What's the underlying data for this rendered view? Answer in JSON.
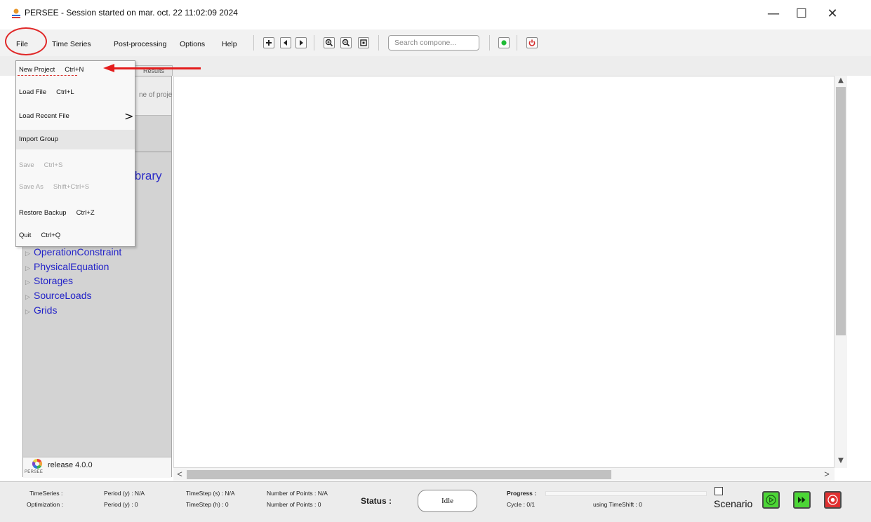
{
  "window": {
    "title": "PERSEE - Session started on mar. oct. 22 11:02:09 2024",
    "minimize_glyph": "—",
    "maximize_glyph": "☐",
    "close_glyph": "✕"
  },
  "menubar": {
    "items": [
      "File",
      "Time Series",
      "Post-processing",
      "Options",
      "Help"
    ],
    "search_placeholder": "Search compone..."
  },
  "tabs": {
    "results": "Results"
  },
  "left_panel": {
    "project_name_fragment": "ne of proje",
    "library_fragment": "ibrary",
    "tree_items": [
      "OperationConstraint",
      "PhysicalEquation",
      "Storages",
      "SourceLoads",
      "Grids"
    ],
    "tree_triangle": "▷",
    "logo_text": "PERSEE",
    "release": "release 4.0.0"
  },
  "file_menu": {
    "items": [
      {
        "label": "New Project",
        "shortcut": "Ctrl+N",
        "enabled": true
      },
      {
        "label": "Load File",
        "shortcut": "Ctrl+L",
        "enabled": true
      },
      {
        "label": "Load Recent File",
        "shortcut": "",
        "submenu_arrow": ">",
        "enabled": true
      },
      {
        "label": "Import Group",
        "shortcut": "",
        "enabled": true,
        "hovered": true
      },
      {
        "label": "Save",
        "shortcut": "Ctrl+S",
        "enabled": false
      },
      {
        "label": "Save As",
        "shortcut": "Shift+Ctrl+S",
        "enabled": false
      },
      {
        "label": "Restore Backup",
        "shortcut": "Ctrl+Z",
        "enabled": true
      },
      {
        "label": "Quit",
        "shortcut": "Ctrl+Q",
        "enabled": true
      }
    ]
  },
  "scroll": {
    "up": "▲",
    "down": "▼",
    "left": "<",
    "right": ">"
  },
  "status": {
    "ts_label": "TimeSeries :",
    "opt_label": "Optimization :",
    "period_y_ts": "Period (y) : N/A",
    "period_y_opt": "Period (y) : 0",
    "timestep_s": "TimeStep (s) : N/A",
    "timestep_h": "TimeStep (h) : 0",
    "npoints_ts": "Number of Points : N/A",
    "npoints_opt": "Number of Points : 0",
    "status_label": "Status :",
    "status_value": "Idle",
    "progress_label": "Progress :",
    "progress_value": 0,
    "cycle": "Cycle : 0/1",
    "timeshift": "using TimeShift : 0",
    "scenario": "Scenario"
  },
  "colors": {
    "annotation_red": "#e41d1d",
    "tree_blue": "#2323c8",
    "green_button": "#4cd636",
    "red_button": "#e03030"
  }
}
